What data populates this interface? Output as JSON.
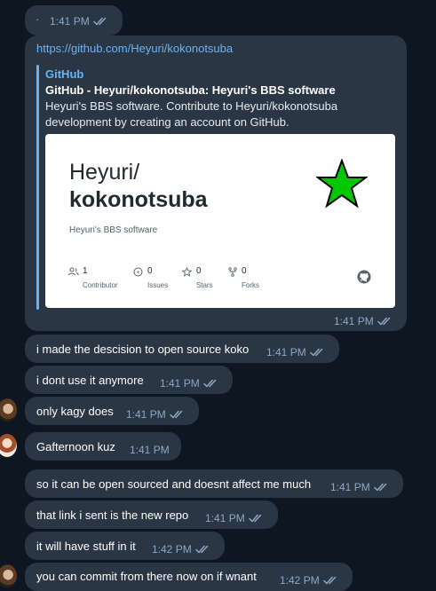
{
  "top_bubble": {
    "text": "·",
    "time": "1:41 PM"
  },
  "link_message": {
    "url": "https://github.com/Heyuri/kokonotsuba",
    "site_name": "GitHub",
    "preview_title": "GitHub - Heyuri/kokonotsuba: Heyuri's BBS software",
    "preview_desc_line1": "Heyuri's BBS software. Contribute to Heyuri/kokonotsuba",
    "preview_desc_line2": "development by creating an account on GitHub.",
    "card": {
      "owner": "Heyuri/",
      "repo": "kokonotsuba",
      "description": "Heyuri's BBS software",
      "stats": [
        {
          "value": "1",
          "label": "Contributor",
          "icon": "people-icon"
        },
        {
          "value": "0",
          "label": "Issues",
          "icon": "issue-icon"
        },
        {
          "value": "0",
          "label": "Stars",
          "icon": "star-icon"
        },
        {
          "value": "0",
          "label": "Forks",
          "icon": "fork-icon"
        }
      ],
      "star_color": "#00c800"
    },
    "time": "1:41 PM"
  },
  "messages": [
    {
      "text": "i made the descision to open source koko",
      "time": "1:41 PM"
    },
    {
      "text": "i dont use it anymore",
      "time": "1:41 PM"
    },
    {
      "text": "only kagy does",
      "time": "1:41 PM"
    },
    {
      "text": "Gafternoon kuz",
      "time": "1:41 PM"
    },
    {
      "text": "so it can be open sourced and doesnt affect me much",
      "time": "1:41 PM"
    },
    {
      "text": "that link i sent is the new repo",
      "time": "1:41 PM"
    },
    {
      "text": "it will have stuff in it",
      "time": "1:42 PM"
    },
    {
      "text": "you can commit from there now on if wnant",
      "time": "1:42 PM"
    }
  ],
  "colors": {
    "background": "#0e1621",
    "incoming_bubble": "#2b3645",
    "link_bubble": "#2b3645",
    "accent": "#6ab3f3",
    "meta": "#8fa7bf"
  }
}
